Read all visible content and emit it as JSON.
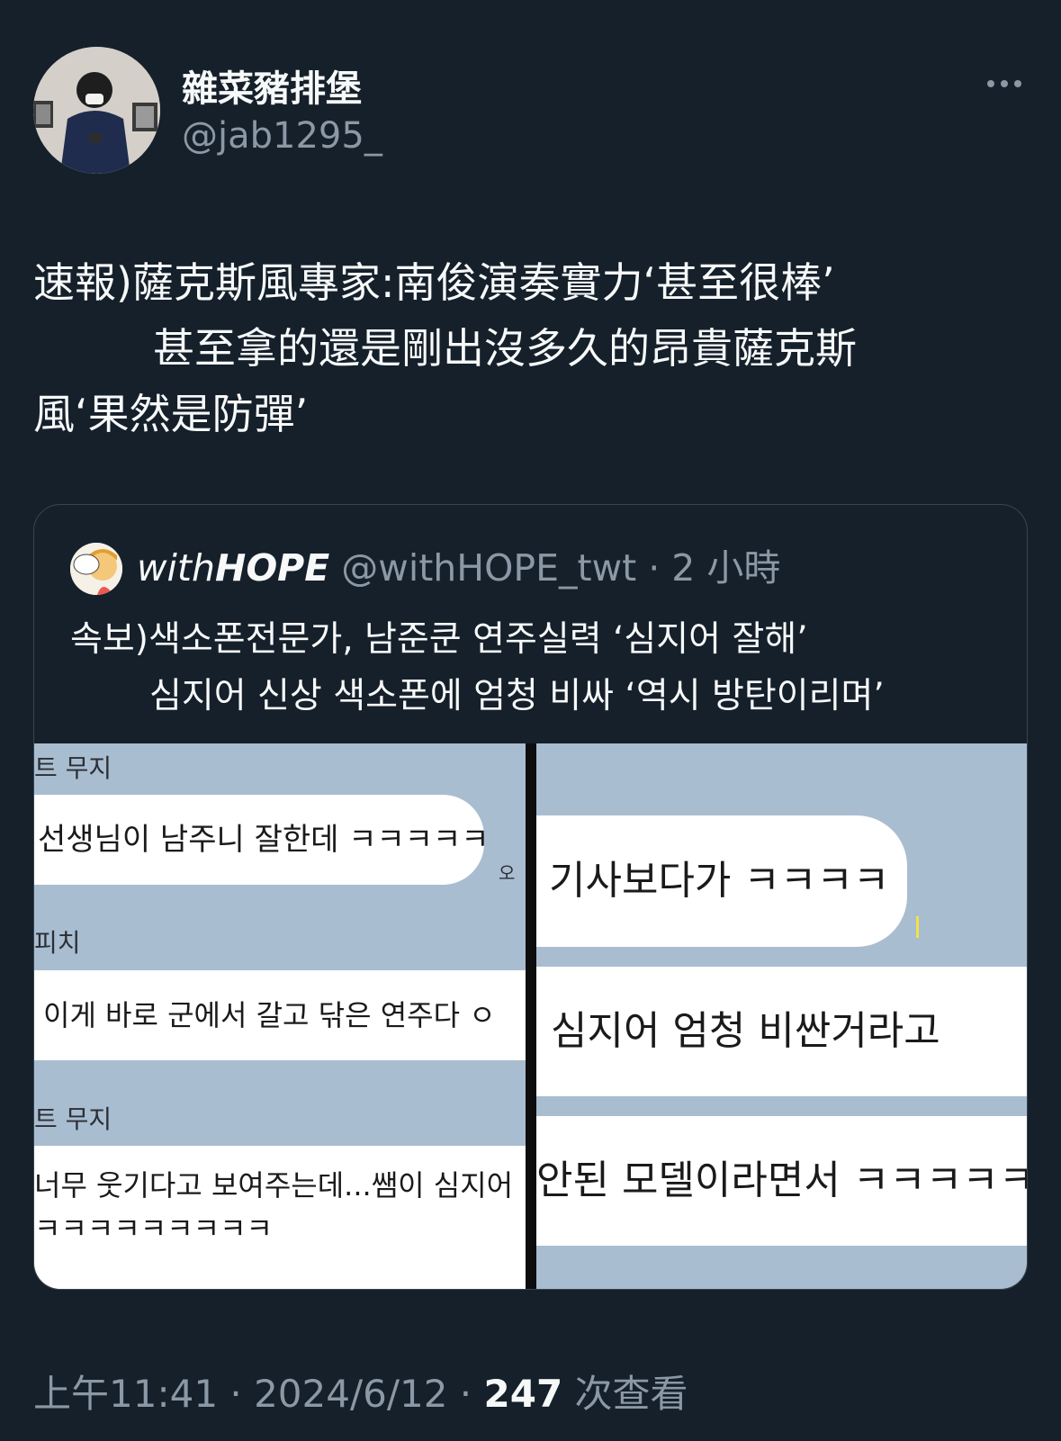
{
  "user": {
    "display_name": "雜菜豬排堡",
    "handle": "@jab1295_"
  },
  "tweet": {
    "line1": "速報)薩克斯風專家:南俊演奏實力‘甚至很棒’",
    "line2": "甚至拿的還是剛出沒多久的昂貴薩克斯",
    "line3": "風‘果然是防彈’"
  },
  "quote": {
    "name_prefix": "with",
    "name_bold": "HOPE",
    "handle_time": "@withHOPE_twt · 2 小時",
    "text_line1": "속보)색소폰전문가, 남준쿤 연주실력 ‘심지어 잘해’",
    "text_line2": "심지어 신상 색소폰에 엄청 비싸 ‘역시 방탄이리며’"
  },
  "media": {
    "left": {
      "sender1": "트 무지",
      "bubble1": "선생님이 남주니 잘한데 ㅋㅋㅋㅋㅋ",
      "time1": "오",
      "sender2": "피치",
      "bubble2": "이게 바로 군에서 갈고 닦은 연주다 ㅇ",
      "sender3": "트 무지",
      "bubble3_line1": "너무 웃기다고 보여주는데...쌤이 심지어",
      "bubble3_line2": "ㅋㅋㅋㅋㅋㅋㅋㅋㅋ"
    },
    "right": {
      "bubble1": "기사보다가 ㅋㅋㅋㅋ",
      "bubble2": "심지어 엄청 비싼거라고",
      "bubble3": "안된 모델이라면서 ㅋㅋㅋㅋㅋ"
    }
  },
  "footer": {
    "datetime": "上午11:41 · 2024/6/12 · ",
    "views_count": "247",
    "views_label": " 次查看"
  }
}
